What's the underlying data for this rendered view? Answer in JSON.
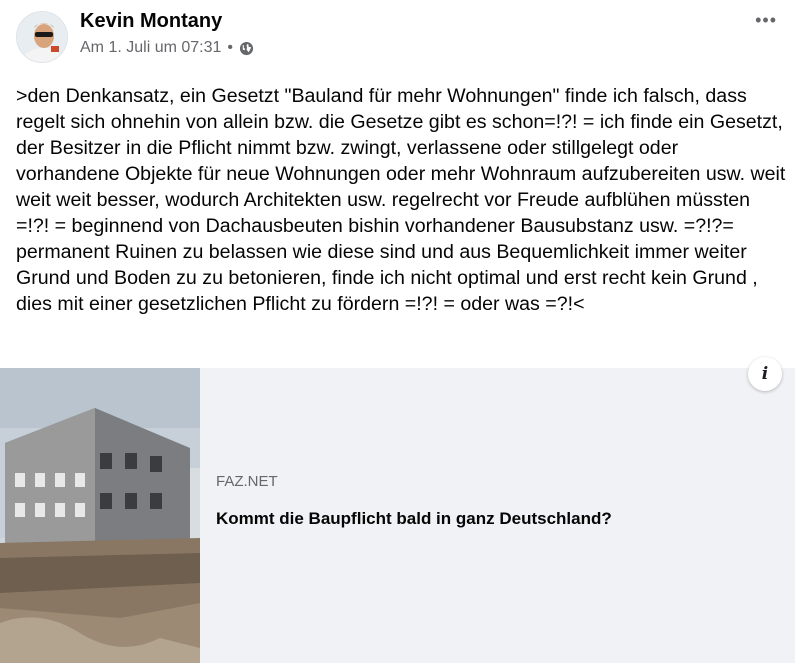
{
  "post": {
    "author": "Kevin Montany",
    "timestamp": "Am 1. Juli um 07:31",
    "separator": "•",
    "privacy_icon": "globe-icon",
    "more_label": "•••",
    "text": ">den Denkansatz, ein Gesetzt \"Bauland für mehr Wohnungen\" finde ich falsch, dass regelt sich ohnehin von allein bzw. die Gesetze gibt es schon=!?! = ich finde ein Gesetzt, der Besitzer in die Pflicht nimmt bzw. zwingt, verlassene oder stillgelegt oder vorhandene Objekte für neue Wohnungen oder mehr Wohnraum aufzubereiten usw. weit weit weit besser, wodurch Architekten usw. regelrecht vor Freude aufblühen müssten =!?! = beginnend von Dachausbeuten bishin vorhandener Bausubstanz usw. =?!?= permanent Ruinen zu belassen wie diese sind und aus Bequemlichkeit immer weiter Grund und Boden zu zu betonieren, finde ich nicht optimal und erst recht kein Grund , dies mit einer gesetzlichen Pflicht zu fördern =!?! = oder was =?!<"
  },
  "link_preview": {
    "source": "FAZ.NET",
    "title": "Kommt die Baupflicht bald in ganz Deutschland?",
    "info_label": "i"
  },
  "colors": {
    "secondary_text": "#65676b",
    "card_background": "#f0f2f5"
  }
}
